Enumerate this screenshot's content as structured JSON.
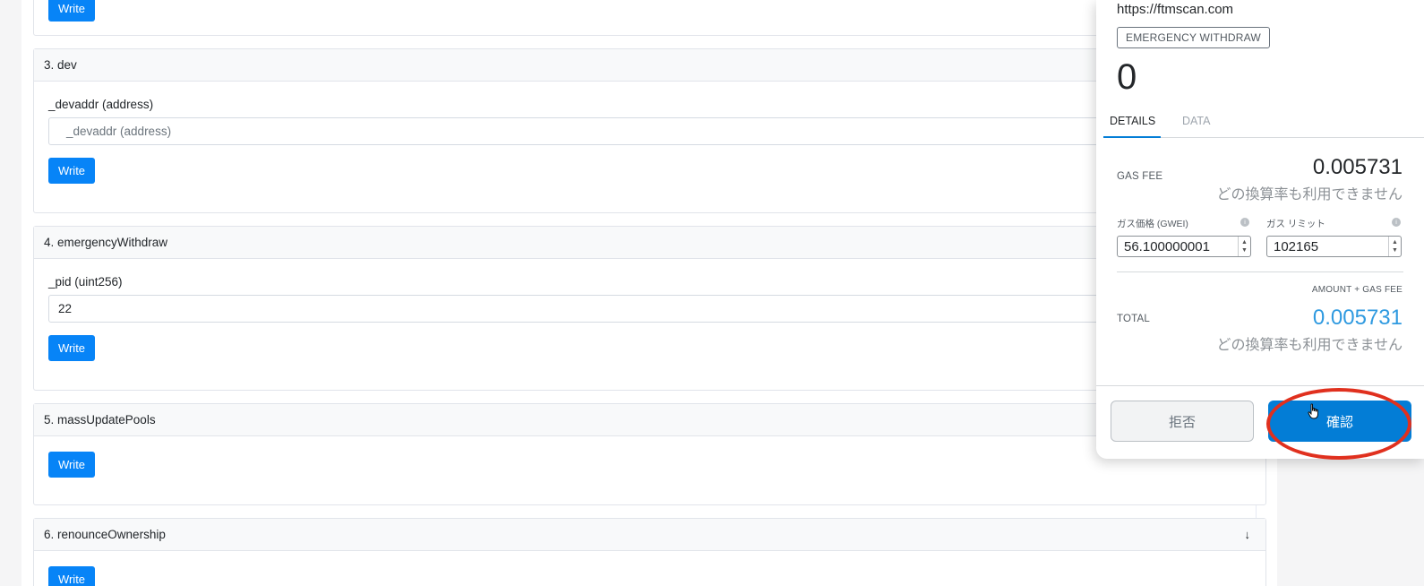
{
  "cards": [
    {
      "title": "3. dev",
      "field_label": "_devaddr (address)",
      "field_placeholder": "_devaddr (address)",
      "field_value": "",
      "write_label": "Write"
    },
    {
      "title": "4. emergencyWithdraw",
      "field_label": "_pid (uint256)",
      "field_placeholder": "",
      "field_value": "22",
      "write_label": "Write"
    },
    {
      "title": "5. massUpdatePools",
      "write_label": "Write"
    },
    {
      "title": "6. renounceOwnership",
      "write_label": "Write"
    }
  ],
  "top_write_label": "Write",
  "wallet": {
    "origin": "https://ftmscan.com",
    "method": "EMERGENCY WITHDRAW",
    "amount": "0",
    "tabs": [
      {
        "label": "DETAILS",
        "active": true
      },
      {
        "label": "DATA",
        "active": false
      }
    ],
    "gas_fee_label": "GAS FEE",
    "gas_fee_value": "0.005731",
    "rate_unavailable": "どの換算率も利用できません",
    "gas_price_label": "ガス価格 (GWEI)",
    "gas_price_value": "56.100000001",
    "gas_limit_label": "ガス リミット",
    "gas_limit_value": "102165",
    "amount_gas_fee_label": "AMOUNT + GAS FEE",
    "total_label": "TOTAL",
    "total_value": "0.005731",
    "reject_label": "拒否",
    "confirm_label": "確認",
    "accent_color": "#037dd6",
    "highlight_color": "#e0301e"
  }
}
